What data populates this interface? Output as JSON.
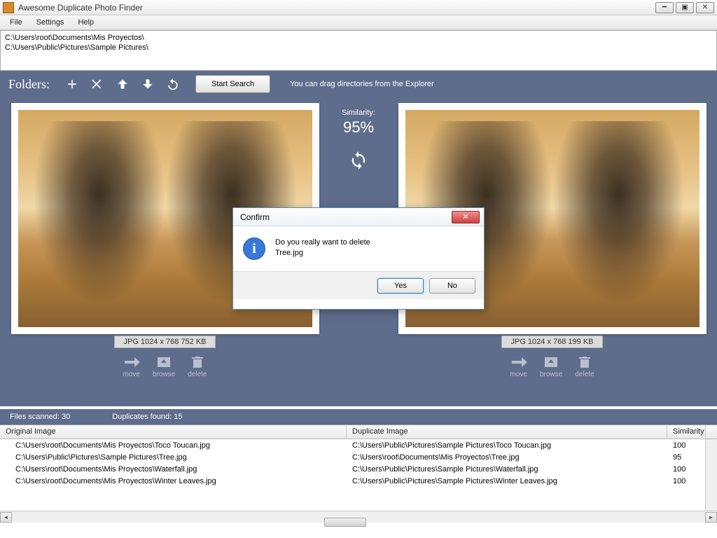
{
  "window": {
    "title": "Awesome Duplicate Photo Finder"
  },
  "menu": {
    "file": "File",
    "settings": "Settings",
    "help": "Help"
  },
  "paths": [
    "C:\\Users\\root\\Documents\\Mis Proyectos\\",
    "C:\\Users\\Public\\Pictures\\Sample Pictures\\"
  ],
  "toolbar": {
    "folders_label": "Folders:",
    "start_search": "Start Search",
    "drag_hint": "You can drag directories from the Explorer"
  },
  "similarity": {
    "label": "Similarity:",
    "value": "95%"
  },
  "left_image": {
    "info": "JPG  1024 x 768  752 KB"
  },
  "right_image": {
    "info": "JPG  1024 x 768  199 KB"
  },
  "actions": {
    "move": "move",
    "browse": "browse",
    "delete": "delete"
  },
  "status": {
    "scanned": "Files scanned: 30",
    "found": "Duplicates found: 15"
  },
  "table": {
    "headers": {
      "orig": "Original Image",
      "dup": "Duplicate Image",
      "sim": "Similarity"
    },
    "rows": [
      {
        "orig": "C:\\Users\\root\\Documents\\Mis Proyectos\\Toco Toucan.jpg",
        "dup": "C:\\Users\\Public\\Pictures\\Sample Pictures\\Toco Toucan.jpg",
        "sim": "100"
      },
      {
        "orig": "C:\\Users\\Public\\Pictures\\Sample Pictures\\Tree.jpg",
        "dup": "C:\\Users\\root\\Documents\\Mis Proyectos\\Tree.jpg",
        "sim": "95"
      },
      {
        "orig": "C:\\Users\\root\\Documents\\Mis Proyectos\\Waterfall.jpg",
        "dup": "C:\\Users\\Public\\Pictures\\Sample Pictures\\Waterfall.jpg",
        "sim": "100"
      },
      {
        "orig": "C:\\Users\\root\\Documents\\Mis Proyectos\\Winter Leaves.jpg",
        "dup": "C:\\Users\\Public\\Pictures\\Sample Pictures\\Winter Leaves.jpg",
        "sim": "100"
      }
    ]
  },
  "dialog": {
    "title": "Confirm",
    "message_l1": "Do you really want to delete",
    "message_l2": "Tree.jpg",
    "yes": "Yes",
    "no": "No"
  }
}
